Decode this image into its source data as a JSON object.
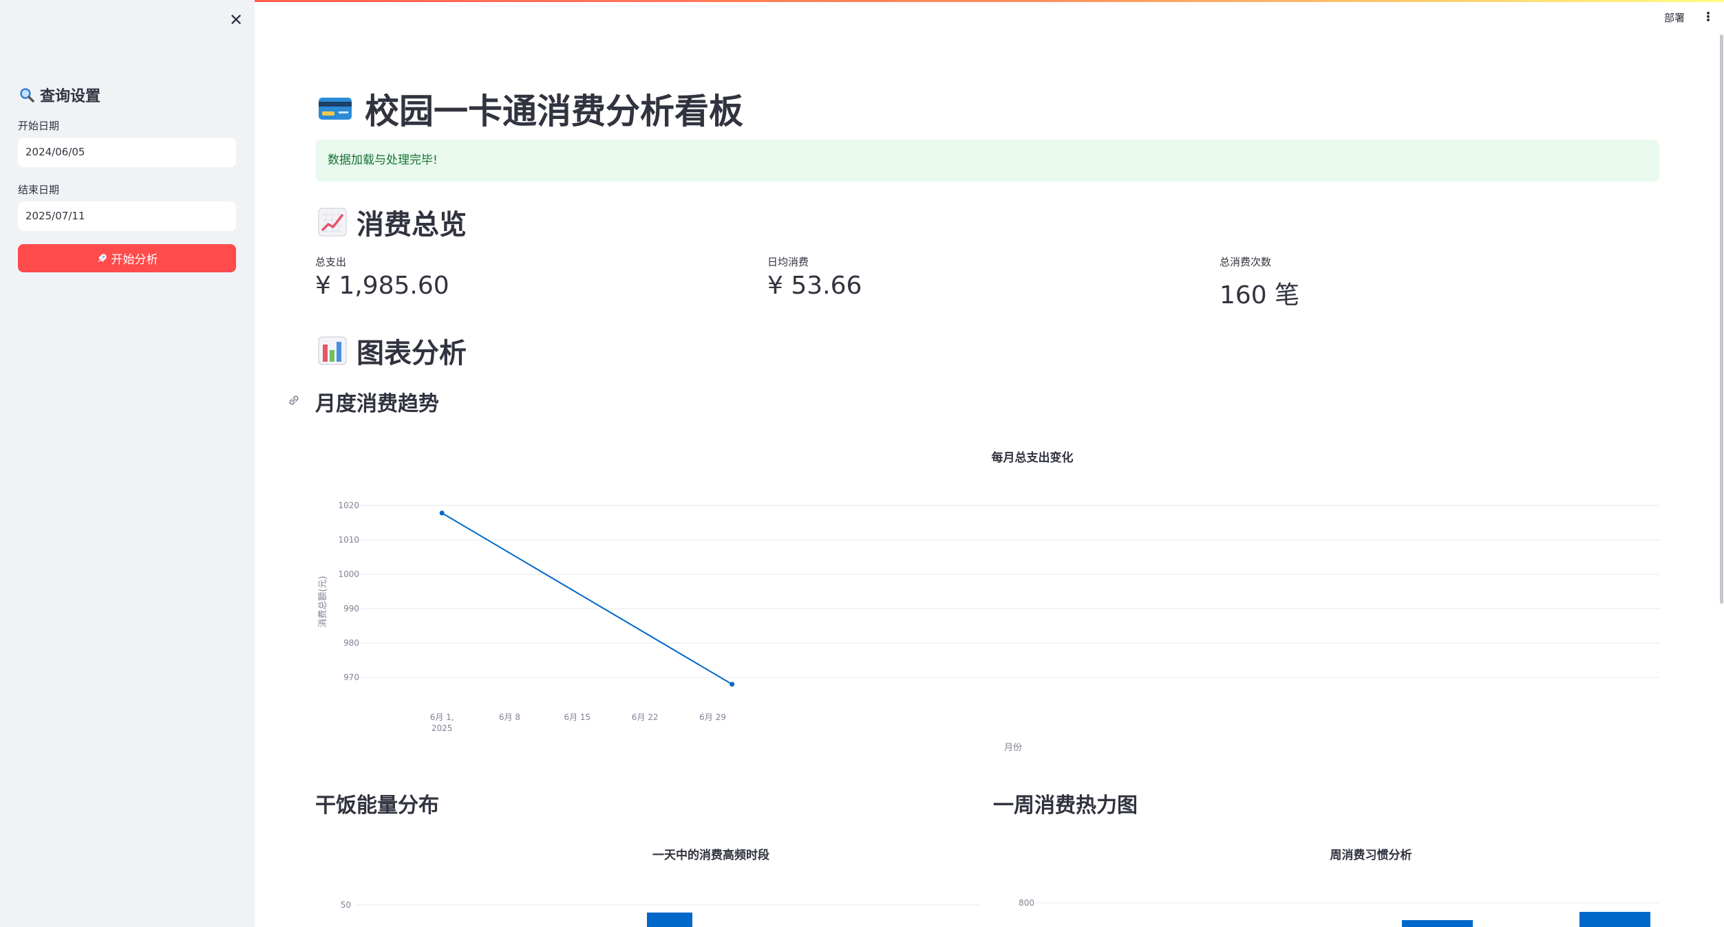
{
  "sidebar": {
    "title": "查询设置",
    "start_label": "开始日期",
    "start_value": "2024/06/05",
    "end_label": "结束日期",
    "end_value": "2025/07/11",
    "button_label": "开始分析"
  },
  "header": {
    "deploy_label": "部署"
  },
  "main": {
    "title": "校园一卡通消费分析看板",
    "success_message": "数据加载与处理完毕!",
    "overview_heading": "消费总览",
    "metrics": [
      {
        "label": "总支出",
        "value": "¥ 1,985.60"
      },
      {
        "label": "日均消费",
        "value": "¥ 53.66"
      },
      {
        "label": "总消费次数",
        "value": "160 笔"
      }
    ],
    "chart_heading": "图表分析",
    "monthly_heading": "月度消费趋势",
    "hour_heading": "干饭能量分布",
    "week_heading": "一周消费热力图"
  },
  "colors": {
    "accent": "#ff4b4b",
    "line": "#0068c9",
    "success_bg": "#e9f9ee",
    "success_text": "#177233",
    "sidebar_bg": "#f0f2f6"
  },
  "chart_data": [
    {
      "type": "line",
      "title": "每月总支出变化",
      "xlabel": "月份",
      "ylabel": "消费总额(元)",
      "x": [
        "2025-06-01",
        "2025-07-01"
      ],
      "y": [
        1017.8,
        968.0
      ],
      "x_ticks": [
        "6月 1, 2025",
        "6月 8",
        "6月 15",
        "6月 22",
        "6月 29"
      ],
      "y_ticks": [
        970,
        980,
        990,
        1000,
        1010,
        1020
      ],
      "ylim": [
        968,
        1020
      ],
      "grid": true
    },
    {
      "type": "bar",
      "title": "一天中的消费高频时段",
      "y_ticks": [
        50
      ],
      "visible_bar_value": 48
    },
    {
      "type": "bar",
      "title": "周消费习惯分析",
      "y_ticks": [
        800
      ],
      "visible_bar_values": [
        780,
        790
      ]
    }
  ]
}
